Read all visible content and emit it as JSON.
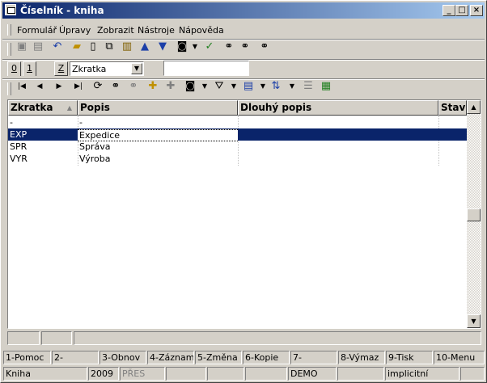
{
  "window": {
    "title": "Číselník - kniha"
  },
  "menu": [
    "Formulář",
    "Úpravy",
    "Zobrazit",
    "Nástroje",
    "Nápověda"
  ],
  "tabs": [
    "0",
    "1"
  ],
  "filter": {
    "button": "Z",
    "combo_value": "Zkratka",
    "text_value": ""
  },
  "grid": {
    "columns": [
      "Zkratka",
      "Popis",
      "Dlouhý popis",
      "Stav"
    ],
    "rows": [
      [
        "-",
        "-",
        "",
        ""
      ],
      [
        "EXP",
        "Expedice",
        "",
        ""
      ],
      [
        "SPR",
        "Správa",
        "",
        ""
      ],
      [
        "VYR",
        "Výroba",
        "",
        ""
      ]
    ],
    "selected_row": 1
  },
  "fkeys": [
    "1-Pomoc",
    "2-",
    "3-Obnov",
    "4-Záznam",
    "5-Změna",
    "6-Kopie",
    "7-",
    "8-Výmaz",
    "9-Tisk",
    "10-Menu"
  ],
  "status": {
    "module": "Kniha",
    "year": "2009",
    "mode": "PŘES",
    "db": "DEMO",
    "profile": "implicitní"
  },
  "colors": {
    "selection": "#0a246a",
    "titlebar": "#0a246a",
    "face": "#d4d0c8"
  }
}
